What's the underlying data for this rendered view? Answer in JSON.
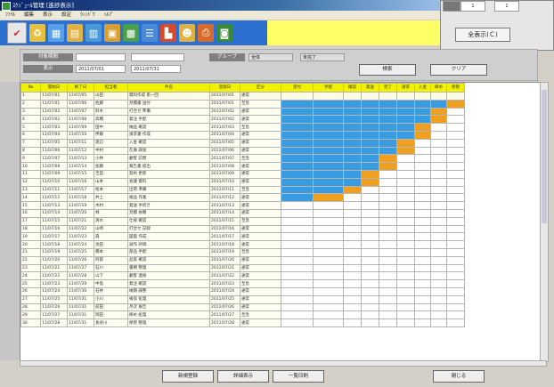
{
  "window": {
    "title": "ｽｹｼﾞｭｰﾙ管理 [進捗表示]"
  },
  "menu": [
    "ﾌｧｲﾙ",
    "編集",
    "表示",
    "設定",
    "ｳｨﾝﾄﾞｳ",
    "ﾍﾙﾌﾟ"
  ],
  "toolbar": {
    "icons": [
      "check-icon",
      "refresh-icon",
      "calendar-icon",
      "table-icon",
      "chart-icon",
      "document-icon",
      "grid-icon",
      "list-icon",
      "graph-icon",
      "user-icon",
      "print-icon",
      "camera-icon"
    ]
  },
  "popup": {
    "button_label": "全表示(Ｃ)",
    "fields": [
      "1",
      "1"
    ]
  },
  "filter": {
    "label_period": "対象期間",
    "label_range": "表示",
    "label_group": "グループ",
    "date_from": "2011/07/01",
    "date_to": "2011/07/31",
    "group_value": "全体",
    "status_value": "未完了",
    "search_button": "検索",
    "clear_button": "クリア"
  },
  "table": {
    "columns": [
      "No",
      "開始日",
      "終了日",
      "担当者",
      "件名",
      "登録日",
      "区分",
      "受付",
      "手配",
      "確認",
      "発送",
      "完了",
      "請求",
      "入金",
      "締め",
      "保管"
    ],
    "rows": [
      {
        "no": "1",
        "start": "11/07/01",
        "end": "11/07/05",
        "person": "山田",
        "title": "資料作成 第一回",
        "reg": "2011/07/01",
        "kind": "通常",
        "status": "bbbbbbbbb"
      },
      {
        "no": "2",
        "start": "11/07/01",
        "end": "11/07/06",
        "person": "佐藤",
        "title": "見積書 送付",
        "reg": "2011/07/01",
        "kind": "至急",
        "status": "bbbbbbbbo"
      },
      {
        "no": "3",
        "start": "11/07/02",
        "end": "11/07/07",
        "person": "鈴木",
        "title": "打合せ 準備",
        "reg": "2011/07/02",
        "kind": "通常",
        "status": "bbbbbbbo"
      },
      {
        "no": "4",
        "start": "11/07/02",
        "end": "11/07/08",
        "person": "高橋",
        "title": "発注 手配",
        "reg": "2011/07/02",
        "kind": "通常",
        "status": "bbbbbbbo"
      },
      {
        "no": "5",
        "start": "11/07/03",
        "end": "11/07/09",
        "person": "田中",
        "title": "納品 確認",
        "reg": "2011/07/03",
        "kind": "至急",
        "status": "bbbbbbo"
      },
      {
        "no": "6",
        "start": "11/07/04",
        "end": "11/07/10",
        "person": "伊藤",
        "title": "請求書 作成",
        "reg": "2011/07/04",
        "kind": "通常",
        "status": "bbbbbbo"
      },
      {
        "no": "7",
        "start": "11/07/05",
        "end": "11/07/11",
        "person": "渡辺",
        "title": "入金 確認",
        "reg": "2011/07/05",
        "kind": "通常",
        "status": "bbbbbo"
      },
      {
        "no": "8",
        "start": "11/07/06",
        "end": "11/07/12",
        "person": "中村",
        "title": "在庫 調査",
        "reg": "2011/07/06",
        "kind": "通常",
        "status": "bbbbbo"
      },
      {
        "no": "9",
        "start": "11/07/07",
        "end": "11/07/13",
        "person": "小林",
        "title": "顧客 訪問",
        "reg": "2011/07/07",
        "kind": "至急",
        "status": "bbbbo"
      },
      {
        "no": "10",
        "start": "11/07/08",
        "end": "11/07/14",
        "person": "加藤",
        "title": "報告書 提出",
        "reg": "2011/07/08",
        "kind": "通常",
        "status": "bbbbo"
      },
      {
        "no": "11",
        "start": "11/07/09",
        "end": "11/07/15",
        "person": "吉田",
        "title": "契約 更新",
        "reg": "2011/07/09",
        "kind": "通常",
        "status": "bbbo"
      },
      {
        "no": "12",
        "start": "11/07/10",
        "end": "11/07/16",
        "person": "山本",
        "title": "会議 資料",
        "reg": "2011/07/10",
        "kind": "通常",
        "status": "bbbo"
      },
      {
        "no": "13",
        "start": "11/07/11",
        "end": "11/07/17",
        "person": "松本",
        "title": "出荷 準備",
        "reg": "2011/07/11",
        "kind": "至急",
        "status": "bbo"
      },
      {
        "no": "14",
        "start": "11/07/12",
        "end": "11/07/18",
        "person": "井上",
        "title": "検品 作業",
        "reg": "2011/07/12",
        "kind": "通常",
        "status": "bo"
      },
      {
        "no": "15",
        "start": "11/07/13",
        "end": "11/07/19",
        "person": "木村",
        "title": "発送 手続き",
        "reg": "2011/07/13",
        "kind": "通常",
        "status": ""
      },
      {
        "no": "16",
        "start": "11/07/14",
        "end": "11/07/20",
        "person": "林",
        "title": "見積 依頼",
        "reg": "2011/07/14",
        "kind": "通常",
        "status": ""
      },
      {
        "no": "17",
        "start": "11/07/15",
        "end": "11/07/21",
        "person": "清水",
        "title": "仕様 確認",
        "reg": "2011/07/15",
        "kind": "至急",
        "status": ""
      },
      {
        "no": "18",
        "start": "11/07/16",
        "end": "11/07/22",
        "person": "山崎",
        "title": "打合せ 記録",
        "reg": "2011/07/16",
        "kind": "通常",
        "status": ""
      },
      {
        "no": "19",
        "start": "11/07/17",
        "end": "11/07/23",
        "person": "森",
        "title": "図面 作成",
        "reg": "2011/07/17",
        "kind": "通常",
        "status": ""
      },
      {
        "no": "20",
        "start": "11/07/18",
        "end": "11/07/24",
        "person": "池田",
        "title": "試作 評価",
        "reg": "2011/07/18",
        "kind": "通常",
        "status": ""
      },
      {
        "no": "21",
        "start": "11/07/19",
        "end": "11/07/25",
        "person": "橋本",
        "title": "部品 手配",
        "reg": "2011/07/19",
        "kind": "至急",
        "status": ""
      },
      {
        "no": "22",
        "start": "11/07/20",
        "end": "11/07/26",
        "person": "阿部",
        "title": "品質 確認",
        "reg": "2011/07/20",
        "kind": "通常",
        "status": ""
      },
      {
        "no": "23",
        "start": "11/07/21",
        "end": "11/07/27",
        "person": "石川",
        "title": "書類 整理",
        "reg": "2011/07/21",
        "kind": "通常",
        "status": ""
      },
      {
        "no": "24",
        "start": "11/07/22",
        "end": "11/07/28",
        "person": "山下",
        "title": "顧客 連絡",
        "reg": "2011/07/22",
        "kind": "通常",
        "status": ""
      },
      {
        "no": "25",
        "start": "11/07/23",
        "end": "11/07/29",
        "person": "中島",
        "title": "発注 確認",
        "reg": "2011/07/23",
        "kind": "至急",
        "status": ""
      },
      {
        "no": "26",
        "start": "11/07/24",
        "end": "11/07/30",
        "person": "石井",
        "title": "納期 調整",
        "reg": "2011/07/24",
        "kind": "通常",
        "status": ""
      },
      {
        "no": "27",
        "start": "11/07/25",
        "end": "11/07/31",
        "person": "小川",
        "title": "検収 処理",
        "reg": "2011/07/25",
        "kind": "通常",
        "status": ""
      },
      {
        "no": "28",
        "start": "11/07/26",
        "end": "11/07/31",
        "person": "前田",
        "title": "月次 報告",
        "reg": "2011/07/26",
        "kind": "通常",
        "status": ""
      },
      {
        "no": "29",
        "start": "11/07/27",
        "end": "11/07/31",
        "person": "岡田",
        "title": "締め 処理",
        "reg": "2011/07/27",
        "kind": "至急",
        "status": ""
      },
      {
        "no": "30",
        "start": "11/07/28",
        "end": "11/07/31",
        "person": "長谷川",
        "title": "保管 整理",
        "reg": "2011/07/28",
        "kind": "通常",
        "status": ""
      }
    ]
  },
  "colors": {
    "done": "#3a9ce0",
    "current": "#f0a020",
    "header": "#f2f200",
    "toolbar": "#2b6fd1"
  },
  "bottom_buttons": [
    "新規登録",
    "詳細表示",
    "一覧印刷"
  ],
  "close_button": "閉じる"
}
